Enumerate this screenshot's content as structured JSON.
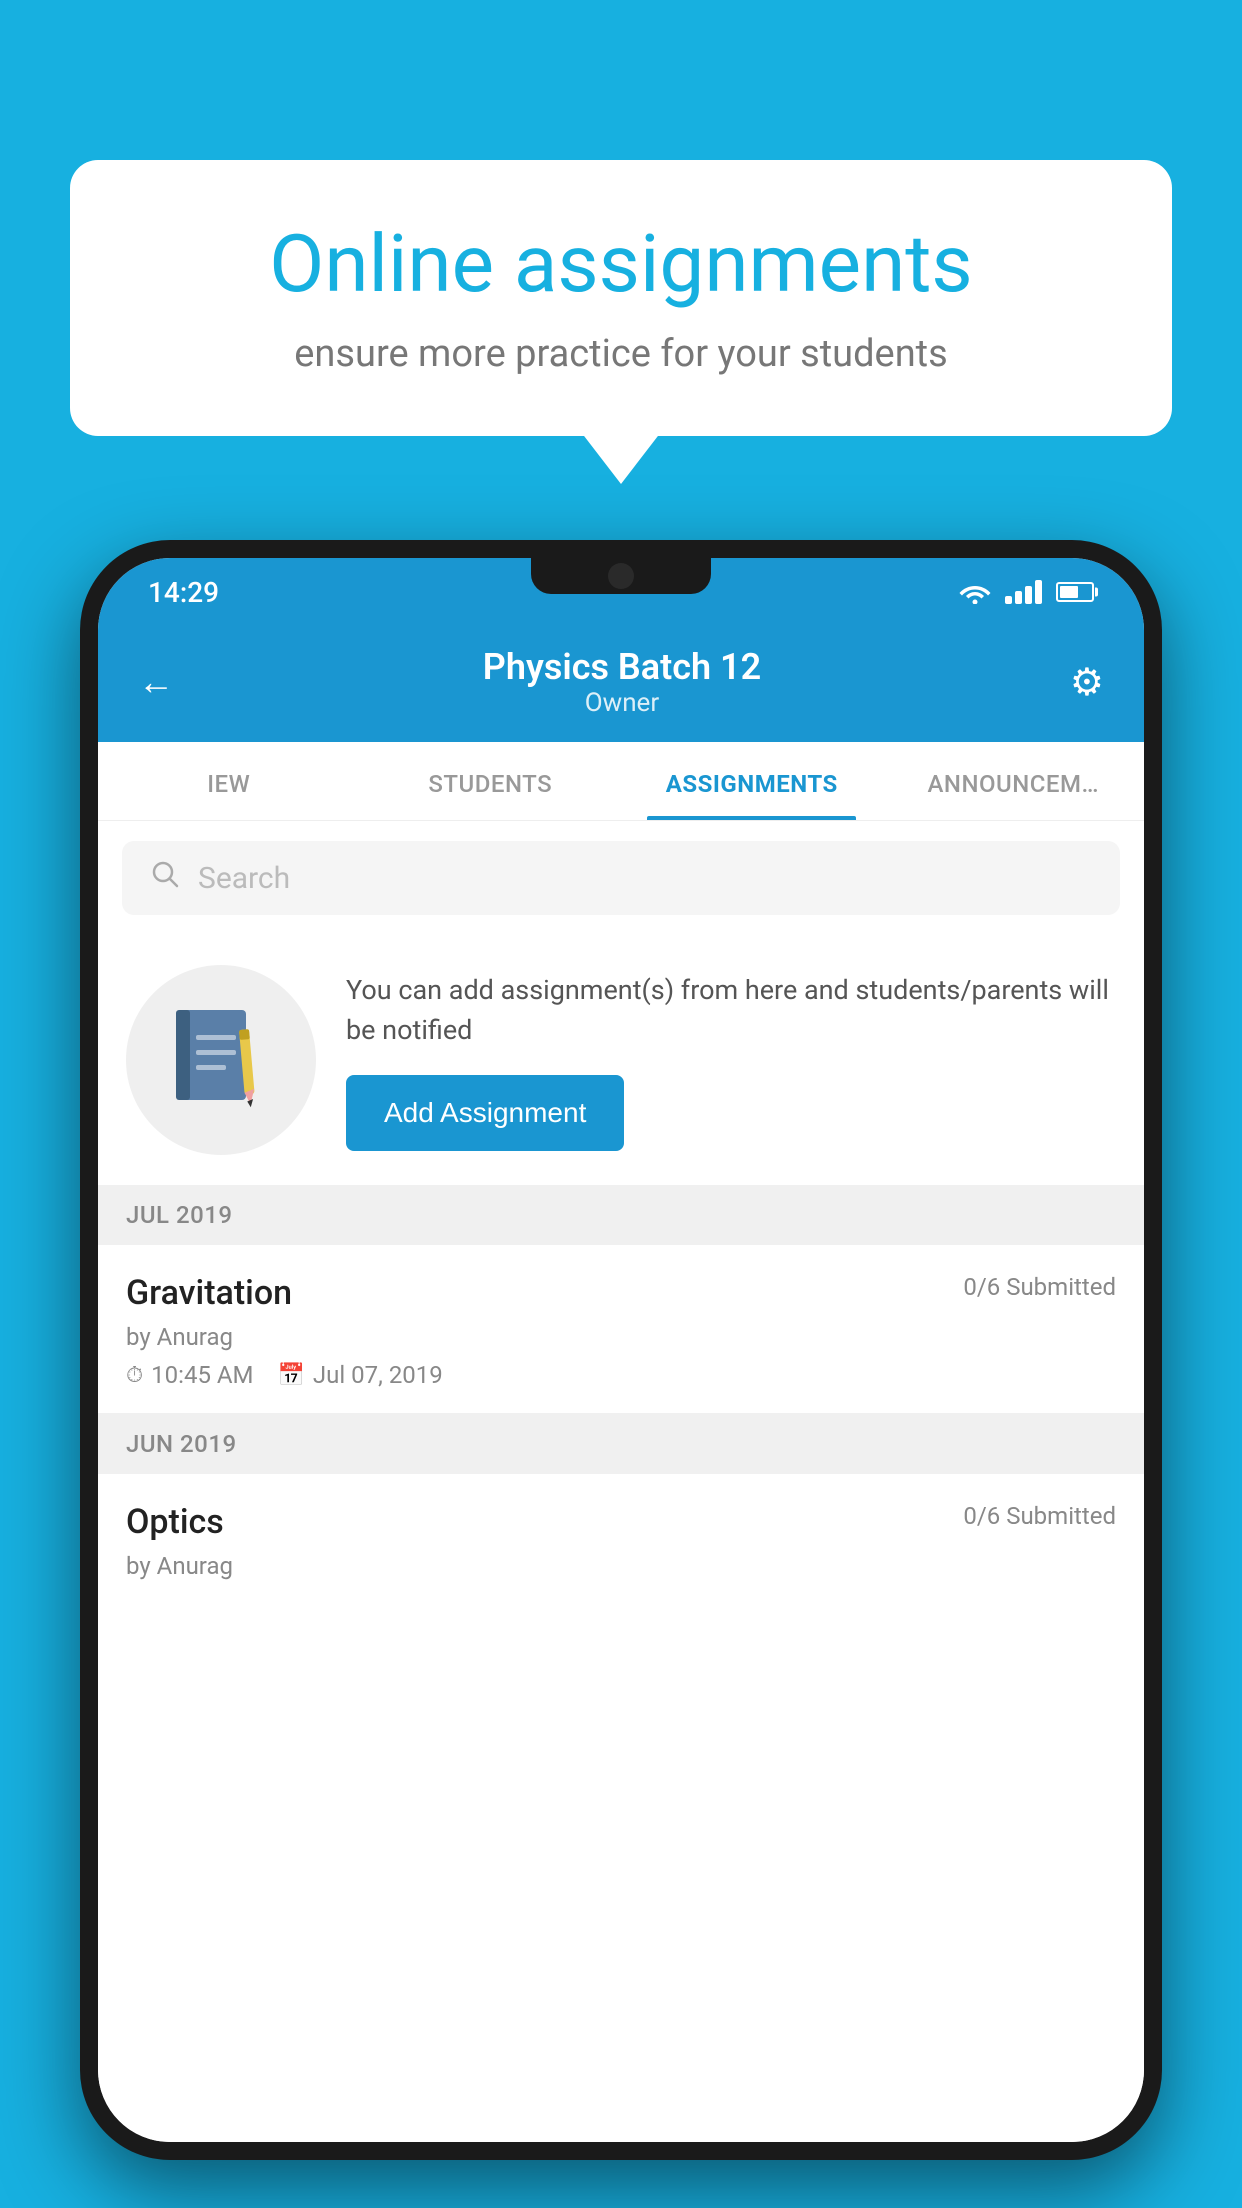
{
  "background_color": "#17b0e0",
  "speech_bubble": {
    "title": "Online assignments",
    "subtitle": "ensure more practice for your students"
  },
  "phone": {
    "status_bar": {
      "time": "14:29"
    },
    "header": {
      "title": "Physics Batch 12",
      "subtitle": "Owner",
      "back_icon": "←",
      "settings_icon": "⚙"
    },
    "tabs": [
      {
        "label": "IEW",
        "active": false
      },
      {
        "label": "STUDENTS",
        "active": false
      },
      {
        "label": "ASSIGNMENTS",
        "active": true
      },
      {
        "label": "ANNOUNCEM…",
        "active": false
      }
    ],
    "search": {
      "placeholder": "Search"
    },
    "promo": {
      "description": "You can add assignment(s) from here and students/parents will be notified",
      "button_label": "Add Assignment"
    },
    "sections": [
      {
        "month": "JUL 2019",
        "assignments": [
          {
            "name": "Gravitation",
            "submitted": "0/6 Submitted",
            "by": "by Anurag",
            "time": "10:45 AM",
            "date": "Jul 07, 2019"
          }
        ]
      },
      {
        "month": "JUN 2019",
        "assignments": [
          {
            "name": "Optics",
            "submitted": "0/6 Submitted",
            "by": "by Anurag",
            "time": "",
            "date": ""
          }
        ]
      }
    ]
  }
}
